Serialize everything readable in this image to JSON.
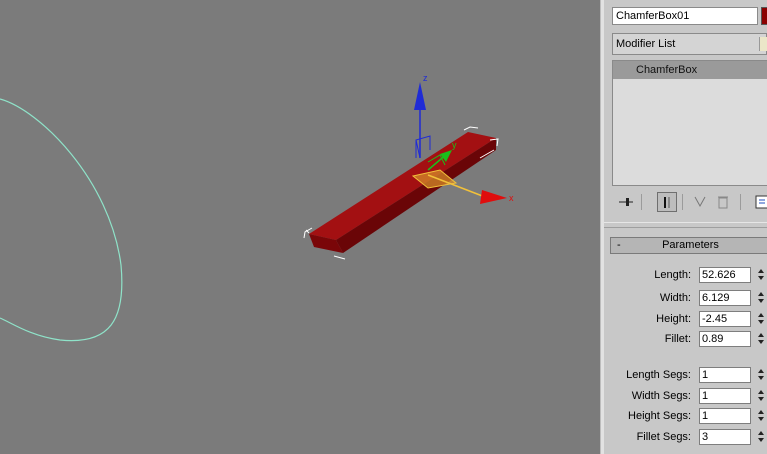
{
  "viewport": {
    "axis_labels": {
      "z": "z",
      "y": "y",
      "x": "x"
    }
  },
  "panel": {
    "object_name": "ChamferBox01",
    "object_color": "#8b0000",
    "modifier_list_label": "Modifier List",
    "stack_items": [
      "ChamferBox"
    ],
    "toolbar_icons": [
      "pin-stack-icon",
      "show-end-result-icon",
      "make-unique-icon",
      "remove-modifier-icon",
      "configure-sets-icon"
    ]
  },
  "parameters": {
    "title": "Parameters",
    "collapse_symbol": "-",
    "fields": [
      {
        "label": "Length:",
        "value": "52.626"
      },
      {
        "label": "Width:",
        "value": "6.129"
      },
      {
        "label": "Height:",
        "value": "-2.45"
      },
      {
        "label": "Fillet:",
        "value": "0.89"
      }
    ],
    "segs": [
      {
        "label": "Length Segs:",
        "value": "1"
      },
      {
        "label": "Width Segs:",
        "value": "1"
      },
      {
        "label": "Height Segs:",
        "value": "1"
      },
      {
        "label": "Fillet Segs:",
        "value": "3"
      }
    ]
  }
}
